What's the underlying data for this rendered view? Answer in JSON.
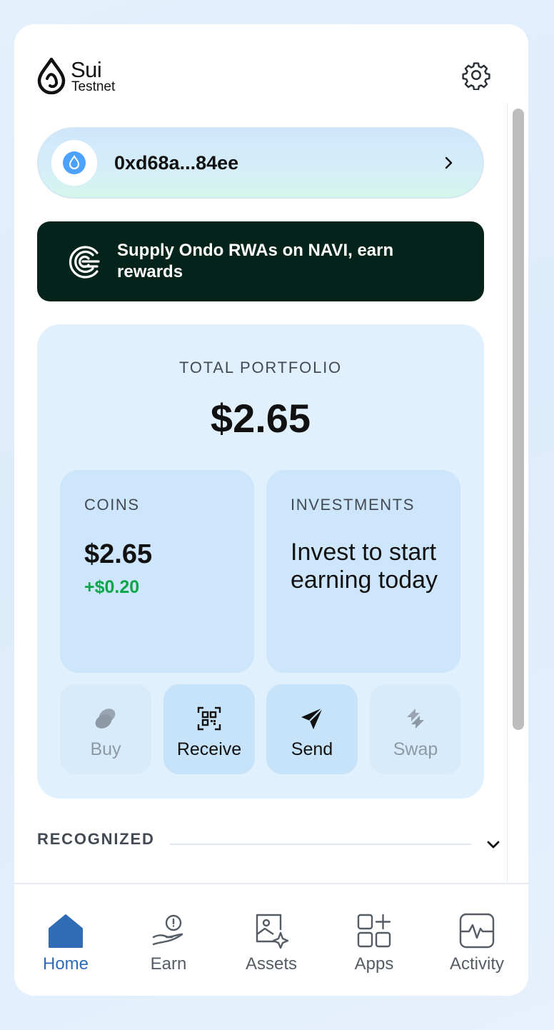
{
  "header": {
    "brand_name": "Sui",
    "network": "Testnet",
    "icons": {
      "logo": "sui-droplet-logo",
      "settings": "gear-icon"
    }
  },
  "account": {
    "address": "0xd68a...84ee",
    "avatar_color": "#4da2ff"
  },
  "promo": {
    "text": "Supply Ondo RWAs on NAVI, earn rewards",
    "background": "#04231a"
  },
  "portfolio": {
    "label": "TOTAL PORTFOLIO",
    "value": "$2.65",
    "coins": {
      "label": "COINS",
      "value": "$2.65",
      "change": "+$0.20",
      "change_color": "#0fa54a"
    },
    "investments": {
      "label": "INVESTMENTS",
      "text": "Invest to start earning today"
    },
    "actions": [
      {
        "label": "Buy",
        "icon": "coins-icon",
        "enabled": false
      },
      {
        "label": "Receive",
        "icon": "qr-code-icon",
        "enabled": true
      },
      {
        "label": "Send",
        "icon": "paper-plane-icon",
        "enabled": true
      },
      {
        "label": "Swap",
        "icon": "swap-arrows-icon",
        "enabled": false
      }
    ]
  },
  "sections": {
    "recognized": "RECOGNIZED"
  },
  "nav": {
    "items": [
      {
        "label": "Home",
        "icon": "home-icon",
        "active": true
      },
      {
        "label": "Earn",
        "icon": "earn-hand-icon",
        "active": false
      },
      {
        "label": "Assets",
        "icon": "assets-image-icon",
        "active": false
      },
      {
        "label": "Apps",
        "icon": "apps-grid-icon",
        "active": false
      },
      {
        "label": "Activity",
        "icon": "activity-pulse-icon",
        "active": false
      }
    ],
    "active_color": "#2f6cb5"
  }
}
